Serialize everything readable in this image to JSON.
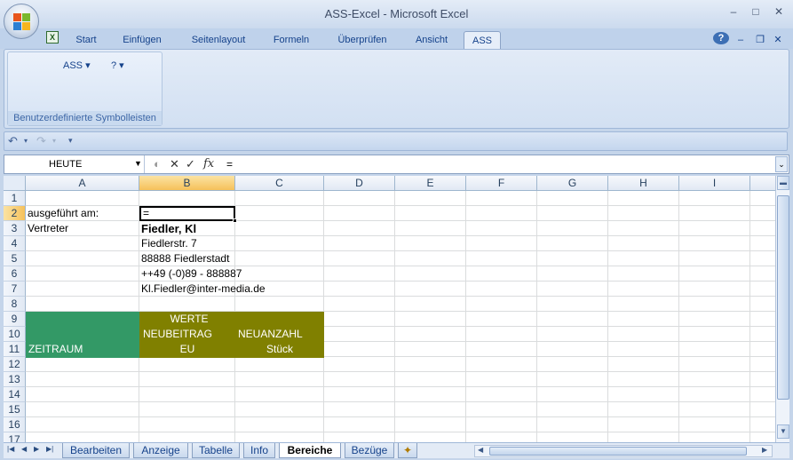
{
  "window": {
    "title": "ASS-Excel - Microsoft Excel",
    "minimize": "–",
    "maximize": "□",
    "close": "✕"
  },
  "ribbon": {
    "tabs": [
      {
        "label": "Start"
      },
      {
        "label": "Einfügen"
      },
      {
        "label": "Seitenlayout"
      },
      {
        "label": "Formeln"
      },
      {
        "label": "Überprüfen"
      },
      {
        "label": "Ansicht"
      },
      {
        "label": "ASS"
      }
    ],
    "active_tab": "ASS",
    "help": "?",
    "group": {
      "btn1": "ASS ▾",
      "btn2": "? ▾",
      "label": "Benutzerdefinierte Symbolleisten"
    }
  },
  "qat": {
    "undo": "↶",
    "redo": "↷",
    "customize": "▾"
  },
  "formula_bar": {
    "name_box": "HEUTE",
    "cancel": "✕",
    "enter": "✓",
    "fx": "fx",
    "formula": "="
  },
  "columns": [
    "A",
    "B",
    "C",
    "D",
    "E",
    "F",
    "G",
    "H",
    "I"
  ],
  "rows": [
    "1",
    "2",
    "3",
    "4",
    "5",
    "6",
    "7",
    "8",
    "9",
    "10",
    "11",
    "12",
    "13",
    "14",
    "15",
    "16",
    "17"
  ],
  "cells": {
    "A2": "ausgeführt am:",
    "B2": "=",
    "A3": "Vertreter",
    "B3": "Fiedler, Kl",
    "B4": "Fiedlerstr. 7",
    "B5": "88888 Fiedlerstadt",
    "B6": "++49 (-0)89 - 888887",
    "B7": "Kl.Fiedler@inter-media.de",
    "B9": "WERTE",
    "B10": "NEUBEITRAG",
    "C10": "NEUANZAHL",
    "A11": "ZEITRAUM",
    "B11": "EU",
    "C11": "Stück"
  },
  "colors": {
    "zeitraum_fill": "#339966",
    "werte_fill": "#808000"
  },
  "sheets": [
    {
      "label": "Bearbeiten"
    },
    {
      "label": "Anzeige"
    },
    {
      "label": "Tabelle"
    },
    {
      "label": "Info"
    },
    {
      "label": "Bereiche"
    },
    {
      "label": "Bezüge"
    }
  ],
  "active_sheet": "Bereiche"
}
